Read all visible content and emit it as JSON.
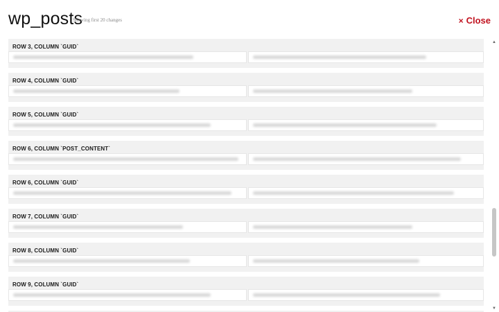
{
  "header": {
    "title": "wp_posts",
    "subtitle": "Showing first 20 changes",
    "close_label": "Close"
  },
  "changes": [
    {
      "label": "ROW 3, COLUMN `GUID`"
    },
    {
      "label": "ROW 4, COLUMN `GUID`"
    },
    {
      "label": "ROW 5, COLUMN `GUID`"
    },
    {
      "label": "ROW 6, COLUMN `POST_CONTENT`"
    },
    {
      "label": "ROW 6, COLUMN `GUID`"
    },
    {
      "label": "ROW 7, COLUMN `GUID`"
    },
    {
      "label": "ROW 8, COLUMN `GUID`"
    },
    {
      "label": "ROW 9, COLUMN `GUID`"
    }
  ],
  "colors": {
    "close": "#c1121f",
    "block_bg": "#f1f1f1",
    "title": "#111111"
  }
}
